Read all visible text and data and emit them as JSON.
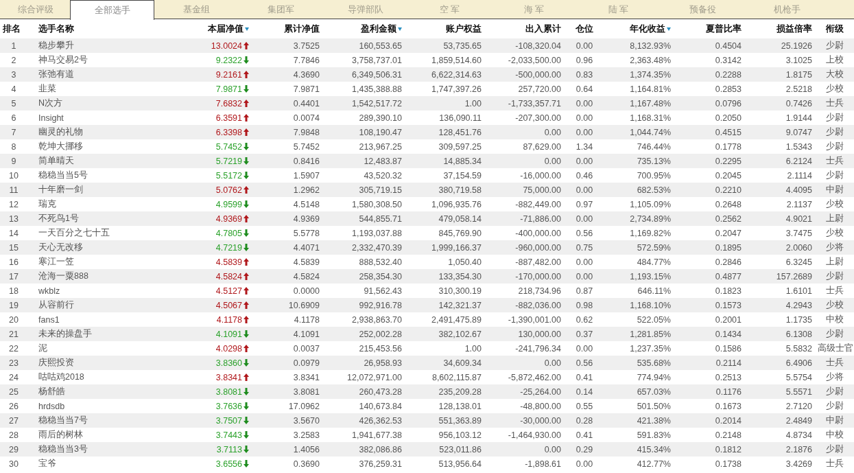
{
  "tabs": [
    {
      "label": "综合评级",
      "selected": false
    },
    {
      "label": "全部选手",
      "selected": true
    },
    {
      "label": "基金组",
      "selected": false
    },
    {
      "label": "集团军",
      "selected": false
    },
    {
      "label": "导弹部队",
      "selected": false
    },
    {
      "label": "空 军",
      "selected": false
    },
    {
      "label": "海 军",
      "selected": false
    },
    {
      "label": "陆 军",
      "selected": false
    },
    {
      "label": "预备役",
      "selected": false
    },
    {
      "label": "机枪手",
      "selected": false
    }
  ],
  "table": {
    "columns": [
      {
        "label": "排名",
        "sortable": false
      },
      {
        "label": "选手名称",
        "sortable": false
      },
      {
        "label": "本届净值",
        "sortable": true
      },
      {
        "label": "累计净值",
        "sortable": false
      },
      {
        "label": "盈利金额",
        "sortable": true
      },
      {
        "label": "账户权益",
        "sortable": false
      },
      {
        "label": "出入累计",
        "sortable": false
      },
      {
        "label": "仓位",
        "sortable": false
      },
      {
        "label": "年化收益",
        "sortable": true
      },
      {
        "label": "夏普比率",
        "sortable": false
      },
      {
        "label": "损益倍率",
        "sortable": false
      },
      {
        "label": "衔级",
        "sortable": false
      }
    ],
    "rows": [
      {
        "rising": true,
        "cells": [
          "1",
          "稳步攀升",
          "13.0024",
          "3.7525",
          "160,553.65",
          "53,735.65",
          "-108,320.04",
          "0.00",
          "8,132.93%",
          "0.4504",
          "25.1926",
          "少尉"
        ]
      },
      {
        "rising": false,
        "cells": [
          "2",
          "神马交易2号",
          "9.2322",
          "7.7846",
          "3,758,737.01",
          "1,859,514.60",
          "-2,033,500.00",
          "0.96",
          "2,363.48%",
          "0.3142",
          "3.1025",
          "上校"
        ]
      },
      {
        "rising": true,
        "cells": [
          "3",
          "张弛有道",
          "9.2161",
          "4.3690",
          "6,349,506.31",
          "6,622,314.63",
          "-500,000.00",
          "0.83",
          "1,374.35%",
          "0.2288",
          "1.8175",
          "大校"
        ]
      },
      {
        "rising": false,
        "cells": [
          "4",
          "韭菜",
          "7.9871",
          "7.9871",
          "1,435,388.88",
          "1,747,397.26",
          "257,720.00",
          "0.64",
          "1,164.81%",
          "0.2853",
          "2.5218",
          "少校"
        ]
      },
      {
        "rising": true,
        "cells": [
          "5",
          "N次方",
          "7.6832",
          "0.4401",
          "1,542,517.72",
          "1.00",
          "-1,733,357.71",
          "0.00",
          "1,167.48%",
          "0.0796",
          "0.7426",
          "士兵"
        ]
      },
      {
        "rising": true,
        "cells": [
          "6",
          "Insight",
          "6.3591",
          "0.0074",
          "289,390.10",
          "136,090.11",
          "-207,300.00",
          "0.00",
          "1,168.31%",
          "0.2050",
          "1.9144",
          "少尉"
        ]
      },
      {
        "rising": true,
        "cells": [
          "7",
          "幽灵的礼物",
          "6.3398",
          "7.9848",
          "108,190.47",
          "128,451.76",
          "0.00",
          "0.00",
          "1,044.74%",
          "0.4515",
          "9.0747",
          "少尉"
        ]
      },
      {
        "rising": false,
        "cells": [
          "8",
          "乾坤大挪移",
          "5.7452",
          "5.7452",
          "213,967.25",
          "309,597.25",
          "87,629.00",
          "1.34",
          "746.44%",
          "0.1778",
          "1.5343",
          "少尉"
        ]
      },
      {
        "rising": false,
        "cells": [
          "9",
          "简单晴天",
          "5.7219",
          "0.8416",
          "12,483.87",
          "14,885.34",
          "0.00",
          "0.00",
          "735.13%",
          "0.2295",
          "6.2124",
          "士兵"
        ]
      },
      {
        "rising": false,
        "cells": [
          "10",
          "稳稳当当5号",
          "5.5172",
          "1.5907",
          "43,520.32",
          "37,154.59",
          "-16,000.00",
          "0.46",
          "700.95%",
          "0.2045",
          "2.1114",
          "少尉"
        ]
      },
      {
        "rising": true,
        "cells": [
          "11",
          "十年磨一剑",
          "5.0762",
          "1.2962",
          "305,719.15",
          "380,719.58",
          "75,000.00",
          "0.00",
          "682.53%",
          "0.2210",
          "4.4095",
          "中尉"
        ]
      },
      {
        "rising": false,
        "cells": [
          "12",
          "瑞克",
          "4.9599",
          "4.5148",
          "1,580,308.50",
          "1,096,935.76",
          "-882,449.00",
          "0.97",
          "1,105.09%",
          "0.2648",
          "2.1137",
          "少校"
        ]
      },
      {
        "rising": true,
        "cells": [
          "13",
          "不死鸟1号",
          "4.9369",
          "4.9369",
          "544,855.71",
          "479,058.14",
          "-71,886.00",
          "0.00",
          "2,734.89%",
          "0.2562",
          "4.9021",
          "上尉"
        ]
      },
      {
        "rising": false,
        "cells": [
          "14",
          "一天百分之七十五",
          "4.7805",
          "5.5778",
          "1,193,037.88",
          "845,769.90",
          "-400,000.00",
          "0.56",
          "1,169.82%",
          "0.2047",
          "3.7475",
          "少校"
        ]
      },
      {
        "rising": false,
        "cells": [
          "15",
          "天心无改移",
          "4.7219",
          "4.4071",
          "2,332,470.39",
          "1,999,166.37",
          "-960,000.00",
          "0.75",
          "572.59%",
          "0.1895",
          "2.0060",
          "少将"
        ]
      },
      {
        "rising": true,
        "cells": [
          "16",
          "寒江一笠",
          "4.5839",
          "4.5839",
          "888,532.40",
          "1,050.40",
          "-887,482.00",
          "0.00",
          "484.77%",
          "0.2846",
          "6.3245",
          "上尉"
        ]
      },
      {
        "rising": true,
        "cells": [
          "17",
          "沧海一粟888",
          "4.5824",
          "4.5824",
          "258,354.30",
          "133,354.30",
          "-170,000.00",
          "0.00",
          "1,193.15%",
          "0.4877",
          "157.2689",
          "少尉"
        ]
      },
      {
        "rising": true,
        "cells": [
          "18",
          "wkblz",
          "4.5127",
          "0.0000",
          "91,562.43",
          "310,300.19",
          "218,734.96",
          "0.87",
          "646.11%",
          "0.1823",
          "1.6101",
          "士兵"
        ]
      },
      {
        "rising": true,
        "cells": [
          "19",
          "从容前行",
          "4.5067",
          "10.6909",
          "992,916.78",
          "142,321.37",
          "-882,036.00",
          "0.98",
          "1,168.10%",
          "0.1573",
          "4.2943",
          "少校"
        ]
      },
      {
        "rising": true,
        "cells": [
          "20",
          "fans1",
          "4.1178",
          "4.1178",
          "2,938,863.70",
          "2,491,475.89",
          "-1,390,001.00",
          "0.62",
          "522.05%",
          "0.2001",
          "1.1735",
          "中校"
        ]
      },
      {
        "rising": false,
        "cells": [
          "21",
          "未来的操盘手",
          "4.1091",
          "4.1091",
          "252,002.28",
          "382,102.67",
          "130,000.00",
          "0.37",
          "1,281.85%",
          "0.1434",
          "6.1308",
          "少尉"
        ]
      },
      {
        "rising": true,
        "cells": [
          "22",
          "泥",
          "4.0298",
          "0.0037",
          "215,453.56",
          "1.00",
          "-241,796.34",
          "0.00",
          "1,237.35%",
          "0.1586",
          "5.5832",
          "高级士官"
        ]
      },
      {
        "rising": false,
        "cells": [
          "23",
          "庆熙投资",
          "3.8360",
          "0.0979",
          "26,958.93",
          "34,609.34",
          "0.00",
          "0.56",
          "535.68%",
          "0.2114",
          "6.4906",
          "士兵"
        ]
      },
      {
        "rising": true,
        "cells": [
          "24",
          "咕咕鸡2018",
          "3.8341",
          "3.8341",
          "12,072,971.00",
          "8,602,115.87",
          "-5,872,462.00",
          "0.41",
          "774.94%",
          "0.2513",
          "5.5754",
          "少将"
        ]
      },
      {
        "rising": false,
        "cells": [
          "25",
          "杨舒皓",
          "3.8081",
          "3.8081",
          "260,473.28",
          "235,209.28",
          "-25,264.00",
          "0.14",
          "657.03%",
          "0.1176",
          "5.5571",
          "少尉"
        ]
      },
      {
        "rising": false,
        "cells": [
          "26",
          "hrdsdb",
          "3.7636",
          "17.0962",
          "140,673.84",
          "128,138.01",
          "-48,800.00",
          "0.55",
          "501.50%",
          "0.1673",
          "2.7120",
          "少尉"
        ]
      },
      {
        "rising": false,
        "cells": [
          "27",
          "稳稳当当7号",
          "3.7507",
          "3.5670",
          "426,362.53",
          "551,363.89",
          "-30,000.00",
          "0.28",
          "421.38%",
          "0.2014",
          "2.4849",
          "中尉"
        ]
      },
      {
        "rising": false,
        "cells": [
          "28",
          "雨后的树林",
          "3.7443",
          "3.2583",
          "1,941,677.38",
          "956,103.12",
          "-1,464,930.00",
          "0.41",
          "591.83%",
          "0.2148",
          "4.8734",
          "中校"
        ]
      },
      {
        "rising": false,
        "cells": [
          "29",
          "稳稳当当3号",
          "3.7113",
          "1.4056",
          "382,086.86",
          "523,011.86",
          "0.00",
          "0.29",
          "415.34%",
          "0.1812",
          "2.1876",
          "少尉"
        ]
      },
      {
        "rising": false,
        "cells": [
          "30",
          "宝爷",
          "3.6556",
          "0.3690",
          "376,259.31",
          "513,956.64",
          "-1,898.61",
          "0.00",
          "412.77%",
          "0.1738",
          "3.4269",
          "士兵"
        ]
      }
    ]
  }
}
